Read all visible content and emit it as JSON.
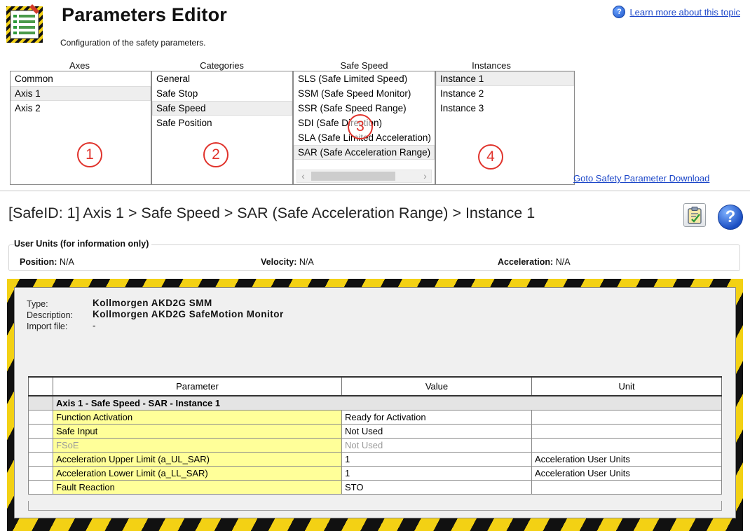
{
  "header": {
    "title": "Parameters Editor",
    "subtitle": "Configuration of the safety parameters.",
    "help_link": "Learn more about this topic"
  },
  "selectors": {
    "axes": {
      "header": "Axes",
      "items": [
        "Common",
        "Axis 1",
        "Axis 2"
      ],
      "selected": "Axis 1"
    },
    "categories": {
      "header": "Categories",
      "items": [
        "General",
        "Safe Stop",
        "Safe Speed",
        "Safe Position"
      ],
      "selected": "Safe Speed"
    },
    "functions": {
      "header": "Safe Speed",
      "items": [
        "SLS (Safe Limited Speed)",
        "SSM (Safe Speed Monitor)",
        "SSR (Safe Speed Range)",
        "SDI (Safe Direction)",
        "SLA (Safe Limited Acceleration)",
        "SAR (Safe Acceleration Range)"
      ],
      "selected": "SAR (Safe Acceleration Range)"
    },
    "instances": {
      "header": "Instances",
      "items": [
        "Instance 1",
        "Instance 2",
        "Instance 3"
      ],
      "selected": "Instance 1"
    }
  },
  "markers": [
    "1",
    "2",
    "3",
    "4"
  ],
  "goto_link": "Goto Safety Parameter Download",
  "breadcrumb": "[SafeID: 1]  Axis 1 > Safe Speed > SAR (Safe Acceleration Range) > Instance 1",
  "user_units": {
    "legend": "User Units (for information only)",
    "position_label": "Position:",
    "position_value": "N/A",
    "velocity_label": "Velocity:",
    "velocity_value": "N/A",
    "acceleration_label": "Acceleration:",
    "acceleration_value": "N/A"
  },
  "device": {
    "type_label": "Type:",
    "type_value": "Kollmorgen AKD2G SMM",
    "description_label": "Description:",
    "description_value": "Kollmorgen AKD2G SafeMotion Monitor",
    "import_label": "Import file:",
    "import_value": "-"
  },
  "table": {
    "columns": [
      "Parameter",
      "Value",
      "Unit"
    ],
    "group": "Axis 1 - Safe Speed - SAR - Instance 1",
    "rows": [
      {
        "parameter": "Function Activation",
        "value": "Ready for Activation",
        "unit": "",
        "disabled": false
      },
      {
        "parameter": "Safe Input",
        "value": "Not Used",
        "unit": "",
        "disabled": false
      },
      {
        "parameter": "FSoE",
        "value": "Not Used",
        "unit": "",
        "disabled": true
      },
      {
        "parameter": "Acceleration Upper Limit (a_UL_SAR)",
        "value": "1",
        "unit": "Acceleration User Units",
        "disabled": false
      },
      {
        "parameter": "Acceleration Lower Limit (a_LL_SAR)",
        "value": "1",
        "unit": "Acceleration User Units",
        "disabled": false
      },
      {
        "parameter": "Fault Reaction",
        "value": "STO",
        "unit": "",
        "disabled": false
      }
    ]
  },
  "icons": {
    "app": "parameters-editor-icon",
    "help": "help-icon",
    "clipboard": "clipboard-check-icon"
  },
  "colors": {
    "link": "#1a45c8",
    "hazard_yellow": "#f3d114",
    "hazard_black": "#111111",
    "param_highlight": "#ffff99",
    "marker_red": "#e0332c"
  }
}
